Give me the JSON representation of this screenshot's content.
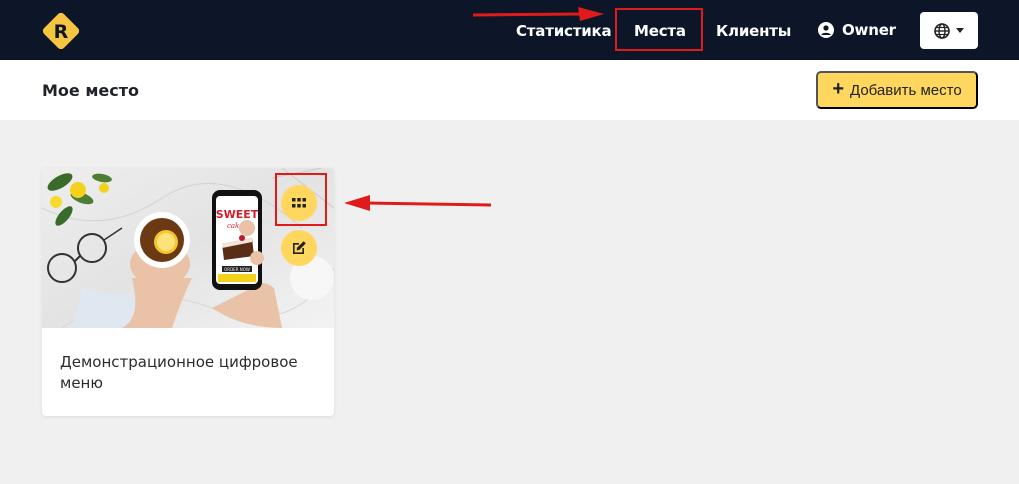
{
  "nav": {
    "logo_letter": "R",
    "statistics": "Статистика",
    "places": "Места",
    "clients": "Клиенты",
    "owner": "Owner",
    "language_icon": "globe-icon"
  },
  "header": {
    "title": "Мое место",
    "add_button": "Добавить место"
  },
  "card": {
    "title": "Демонстрационное цифровое меню",
    "image_text": {
      "phone_headline": "SWEET",
      "phone_subline": "cakes",
      "phone_button": "ORDER NOW"
    },
    "actions": [
      "grid-icon",
      "edit-icon"
    ]
  },
  "colors": {
    "topbar": "#0d1629",
    "accent": "#ffd75e",
    "annotation": "#e01b1b",
    "background": "#f0f0f0"
  }
}
